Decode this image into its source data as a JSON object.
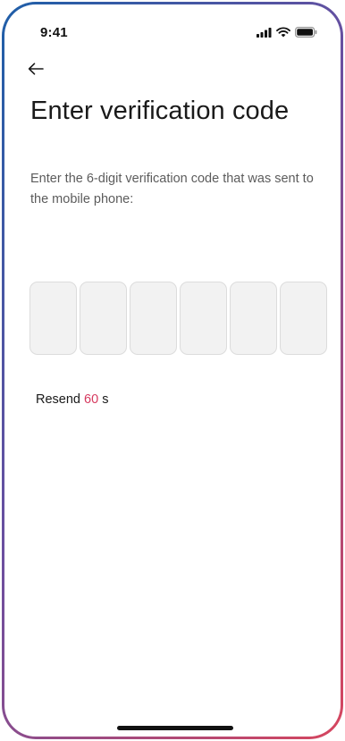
{
  "status_bar": {
    "time": "9:41",
    "icons": [
      "cellular-signal-icon",
      "wifi-icon",
      "battery-icon"
    ]
  },
  "navigation": {
    "back_icon": "arrow-left-icon"
  },
  "title": "Enter verification code",
  "subtitle": "Enter the 6-digit verification code that was sent to the mobile phone:",
  "code_inputs": [
    "",
    "",
    "",
    "",
    "",
    ""
  ],
  "resend": {
    "label": "Resend",
    "countdown": "60",
    "unit": "s"
  },
  "colors": {
    "accent": "#d63a5f",
    "input_background": "#f2f2f2",
    "frame_start": "#1e5fa8",
    "frame_end": "#d7465e"
  }
}
